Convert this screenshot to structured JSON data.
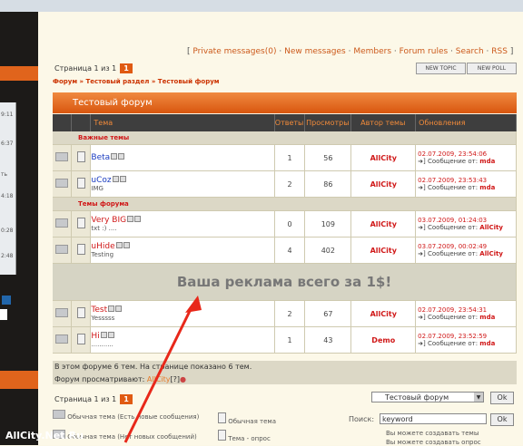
{
  "sidebar": {
    "frags": [
      "9:11",
      "6:37",
      "ть",
      "4:18",
      "0:28",
      "2:48"
    ]
  },
  "toplinks": [
    "Private messages(0)",
    "New messages",
    "Members",
    "Forum rules",
    "Search",
    "RSS"
  ],
  "pager": {
    "text": "Страница 1 из 1",
    "current": "1"
  },
  "buttons": {
    "new_topic": "NEW TOPIC",
    "new_poll": "NEW POLL"
  },
  "breadcrumb": "Форум » Тестовый раздел » Тестовый форум",
  "forum_title": "Тестовый форум",
  "columns": [
    "Тема",
    "Ответы",
    "Просмотры",
    "Автор темы",
    "Обновления"
  ],
  "sections": {
    "important": "Важные темы",
    "forum": "Темы форума"
  },
  "important_topics": [
    {
      "title": "Beta",
      "desc": "",
      "replies": "1",
      "views": "56",
      "author": "AllCity",
      "date": "02.07.2009, 23:54:06",
      "by_label": "Сообщение от:",
      "by": "mda"
    },
    {
      "title": "uCoz",
      "desc": "IMG",
      "replies": "2",
      "views": "86",
      "author": "AllCity",
      "date": "02.07.2009, 23:53:43",
      "by_label": "Сообщение от:",
      "by": "mda"
    }
  ],
  "forum_topics": [
    {
      "title": "Very BIG",
      "desc": "txt :) ....",
      "replies": "0",
      "views": "109",
      "author": "AllCity",
      "date": "03.07.2009, 01:24:03",
      "by_label": "Сообщение от:",
      "by": "AllCity"
    },
    {
      "title": "uHide",
      "desc": "Testing",
      "replies": "4",
      "views": "402",
      "author": "AllCity",
      "date": "03.07.2009, 00:02:49",
      "by_label": "Сообщение от:",
      "by": "AllCity"
    }
  ],
  "ad_text": "Ваша реклама всего за 1$!",
  "more_topics": [
    {
      "title": "Test",
      "desc": "Yesssss",
      "replies": "2",
      "views": "67",
      "author": "AllCity",
      "date": "02.07.2009, 23:54:31",
      "by_label": "Сообщение от:",
      "by": "mda"
    },
    {
      "title": "Hi",
      "desc": "...........",
      "replies": "1",
      "views": "43",
      "author": "Demo",
      "date": "02.07.2009, 23:52:59",
      "by_label": "Сообщение от:",
      "by": "mda"
    }
  ],
  "footer": {
    "count_text": "В этом форуме 6 тем. На странице показано 6 тем.",
    "viewing_label": "Форум просматривают:",
    "viewing_user": "AllCity",
    "viewing_suffix": "[?]"
  },
  "jump": {
    "selected": "Тестовый форум",
    "ok": "Ok"
  },
  "search": {
    "label": "Поиск:",
    "value": "keyword",
    "ok": "Ok"
  },
  "legend": {
    "normal_new": "Обычная тема (Есть новые сообщения)",
    "normal_nonew": "Обычная тема (Нет новых сообщений)",
    "normal": "Обычная тема",
    "poll": "Тема - опрос"
  },
  "perms": {
    "create_topic": "Вы можете создавать темы",
    "create_poll": "Вы можете создавать опрос"
  },
  "watermark": "AllCity.Net.Ru"
}
